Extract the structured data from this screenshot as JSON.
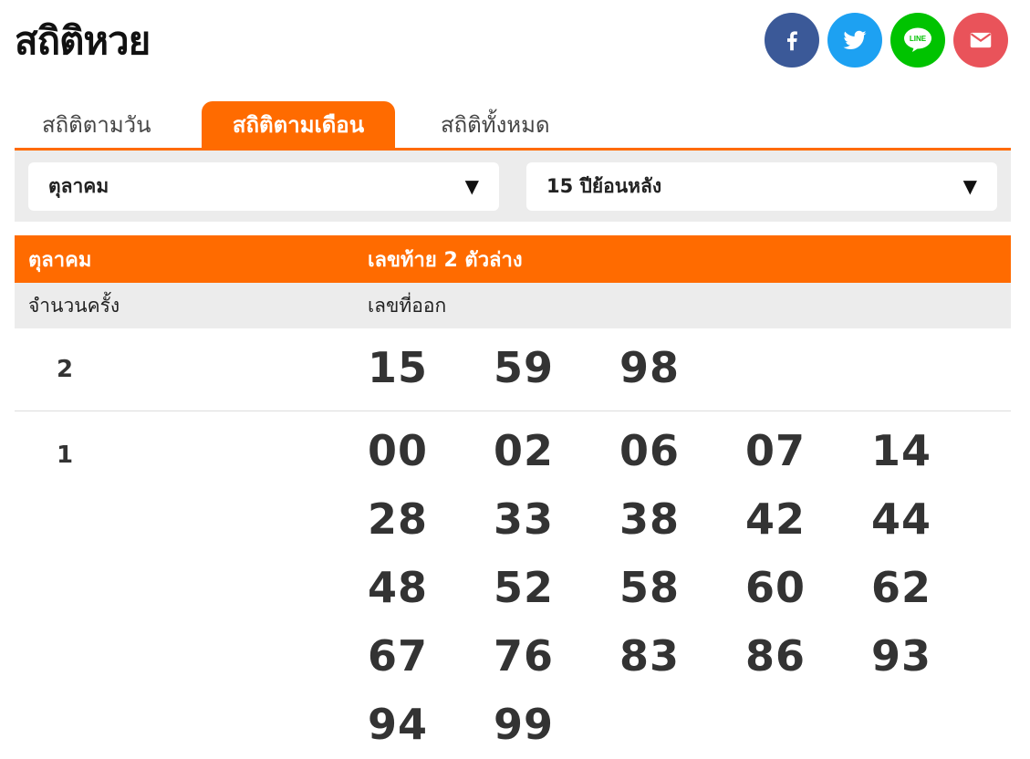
{
  "page": {
    "title": "สถิติหวย"
  },
  "share": {
    "colors": {
      "facebook": "#3b5998",
      "twitter": "#1da1f2",
      "line": "#00c300",
      "email": "#e9535a"
    },
    "line_label": "LINE"
  },
  "tabs": [
    {
      "label": "สถิติตามวัน",
      "active": false
    },
    {
      "label": "สถิติตามเดือน",
      "active": true
    },
    {
      "label": "สถิติทั้งหมด",
      "active": false
    }
  ],
  "filters": {
    "month": {
      "value": "ตุลาคม",
      "arrow": "▼"
    },
    "range": {
      "value": "15 ปีย้อนหลัง",
      "arrow": "▼"
    }
  },
  "table": {
    "header": {
      "month": "ตุลาคม",
      "type": "เลขท้าย 2 ตัวล่าง"
    },
    "subheader": {
      "count": "จำนวนครั้ง",
      "numbers": "เลขที่ออก"
    },
    "rows": [
      {
        "count": "2",
        "numbers": [
          "15",
          "59",
          "98"
        ]
      },
      {
        "count": "1",
        "numbers": [
          "00",
          "02",
          "06",
          "07",
          "14",
          "28",
          "33",
          "38",
          "42",
          "44",
          "48",
          "52",
          "58",
          "60",
          "62",
          "67",
          "76",
          "83",
          "86",
          "93",
          "94",
          "99"
        ]
      }
    ]
  },
  "accent_color": "#ff6b00"
}
